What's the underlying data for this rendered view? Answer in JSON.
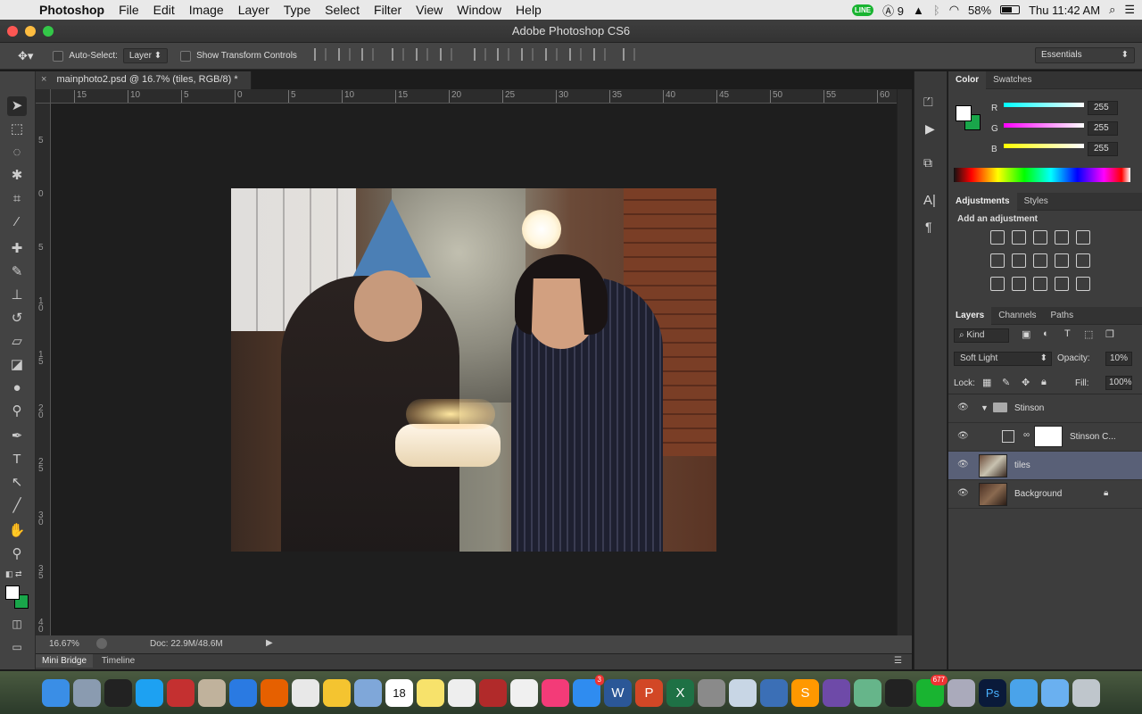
{
  "menubar": {
    "apple": "",
    "items": [
      "Photoshop",
      "File",
      "Edit",
      "Image",
      "Layer",
      "Type",
      "Select",
      "Filter",
      "View",
      "Window",
      "Help"
    ],
    "status": {
      "line": "LINE",
      "adobe_count": "9",
      "battery": "58%",
      "clock": "Thu 11:42 AM"
    }
  },
  "window": {
    "title": "Adobe Photoshop CS6"
  },
  "options_bar": {
    "auto_select_label": "Auto-Select:",
    "auto_select_value": "Layer",
    "show_transform_label": "Show Transform Controls",
    "workspace": "Essentials"
  },
  "document": {
    "tab_title": "mainphoto2.psd @ 16.7% (tiles, RGB/8) *",
    "ruler_h": [
      "15",
      "10",
      "5",
      "0",
      "5",
      "10",
      "15",
      "20",
      "25",
      "30",
      "35",
      "40",
      "45",
      "50",
      "55",
      "60"
    ],
    "ruler_v": [
      "5",
      "0",
      "5",
      "1 0",
      "1 5",
      "2 0",
      "2 5",
      "3 0",
      "3 5",
      "4 0"
    ],
    "zoom": "16.67%",
    "doc_size": "Doc: 22.9M/48.6M"
  },
  "bottom_tabs": [
    "Mini Bridge",
    "Timeline"
  ],
  "color_panel": {
    "tabs": [
      "Color",
      "Swatches"
    ],
    "channels": [
      {
        "label": "R",
        "value": "255"
      },
      {
        "label": "G",
        "value": "255"
      },
      {
        "label": "B",
        "value": "255"
      }
    ]
  },
  "adjustments_panel": {
    "tabs": [
      "Adjustments",
      "Styles"
    ],
    "title": "Add an adjustment"
  },
  "layers_panel": {
    "tabs": [
      "Layers",
      "Channels",
      "Paths"
    ],
    "filter_kind": "Kind",
    "blend_mode": "Soft Light",
    "opacity_label": "Opacity:",
    "opacity_value": "10%",
    "lock_label": "Lock:",
    "fill_label": "Fill:",
    "fill_value": "100%",
    "layers": [
      {
        "name": "Stinson",
        "kind": "group"
      },
      {
        "name": "Stinson C...",
        "kind": "adjustment"
      },
      {
        "name": "tiles",
        "kind": "pixel",
        "selected": true
      },
      {
        "name": "Background",
        "kind": "background"
      }
    ]
  },
  "dock": {
    "apps": [
      "finder",
      "launchpad",
      "dashboard",
      "twitter",
      "tweetbot",
      "preview",
      "safari",
      "firefox",
      "chrome",
      "tips",
      "mail",
      "calendar",
      "notes",
      "reminders",
      "photo-booth",
      "photos",
      "itunes",
      "app-store",
      "word",
      "powerpoint",
      "excel",
      "system-preferences",
      "settings",
      "sequel",
      "sublime",
      "github",
      "atom",
      "terminal",
      "line",
      "image-capture",
      "photoshop",
      "downloads",
      "documents",
      "trash"
    ],
    "calendar_date": "18",
    "appstore_badge": "3",
    "line_badge": "677"
  }
}
